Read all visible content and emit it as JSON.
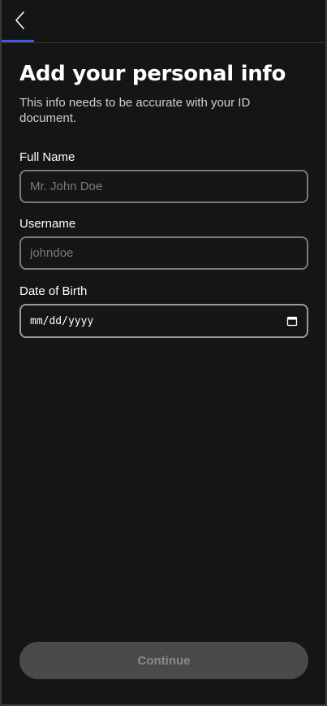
{
  "header": {
    "back_icon": "chevron-left-icon"
  },
  "page": {
    "title": "Add your personal info",
    "subtitle": "This info needs to be accurate with your ID document."
  },
  "form": {
    "full_name": {
      "label": "Full Name",
      "placeholder": "Mr. John Doe",
      "value": ""
    },
    "username": {
      "label": "Username",
      "placeholder": "johndoe",
      "value": ""
    },
    "dob": {
      "label": "Date of Birth",
      "placeholder": "mm/dd/yyyy",
      "icon": "calendar-icon"
    }
  },
  "footer": {
    "continue_label": "Continue",
    "continue_enabled": false
  },
  "colors": {
    "background": "#151515",
    "accent": "#3b5bdb",
    "text": "#ffffff",
    "muted_text": "#cfcfcf",
    "placeholder": "#7a7a7a",
    "input_border": "#7a7a7a",
    "button_disabled_bg": "#4a4a4a",
    "button_disabled_text": "#8a8a8a"
  }
}
